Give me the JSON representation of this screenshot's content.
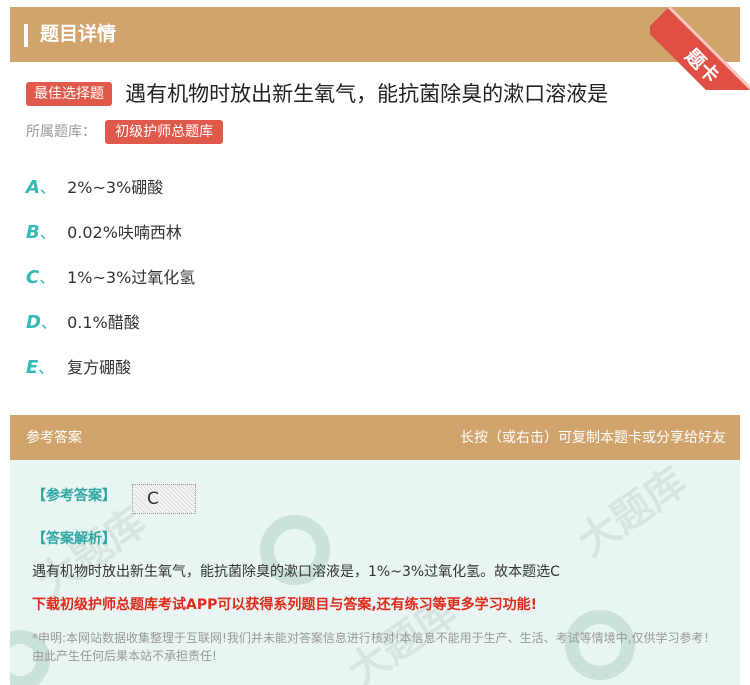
{
  "header": {
    "title": "题目详情",
    "corner_badge": "题卡"
  },
  "question": {
    "type_tag": "最佳选择题",
    "text": "遇有机物时放出新生氧气，能抗菌除臭的漱口溶液是",
    "bank_label": "所属题库：",
    "bank_name": "初级护师总题库"
  },
  "options": [
    {
      "letter": "A",
      "sep": "、",
      "text": "2%~3%硼酸"
    },
    {
      "letter": "B",
      "sep": "、",
      "text": "0.02%呋喃西林"
    },
    {
      "letter": "C",
      "sep": "、",
      "text": "1%~3%过氧化氢"
    },
    {
      "letter": "D",
      "sep": "、",
      "text": "0.1%醋酸"
    },
    {
      "letter": "E",
      "sep": "、",
      "text": "复方硼酸"
    }
  ],
  "answer_section": {
    "title": "参考答案",
    "hint": "长按（或右击）可复制本题卡或分享给好友",
    "answer_label": "【参考答案】",
    "answer_value": "C",
    "analysis_label": "【答案解析】",
    "analysis_text": "遇有机物时放出新生氧气，能抗菌除臭的漱口溶液是，1%~3%过氧化氢。故本题选C",
    "promo_text": "下载初级护师总题库考试APP可以获得系列题目与答案,还有练习等更多学习功能!",
    "disclaimer": "*申明:本网站数据收集整理于互联网!我们并未能对答案信息进行核对!本信息不能用于生产、生活、考试等情境中,仅供学习参考！由此产生任何后果本站不承担责任!"
  },
  "colors": {
    "header_bg": "#d1a46d",
    "tag_red": "#e05a4b",
    "option_letter": "#34b9b7",
    "answer_bg": "#e9f5f2",
    "promo_red": "#e0281b"
  }
}
